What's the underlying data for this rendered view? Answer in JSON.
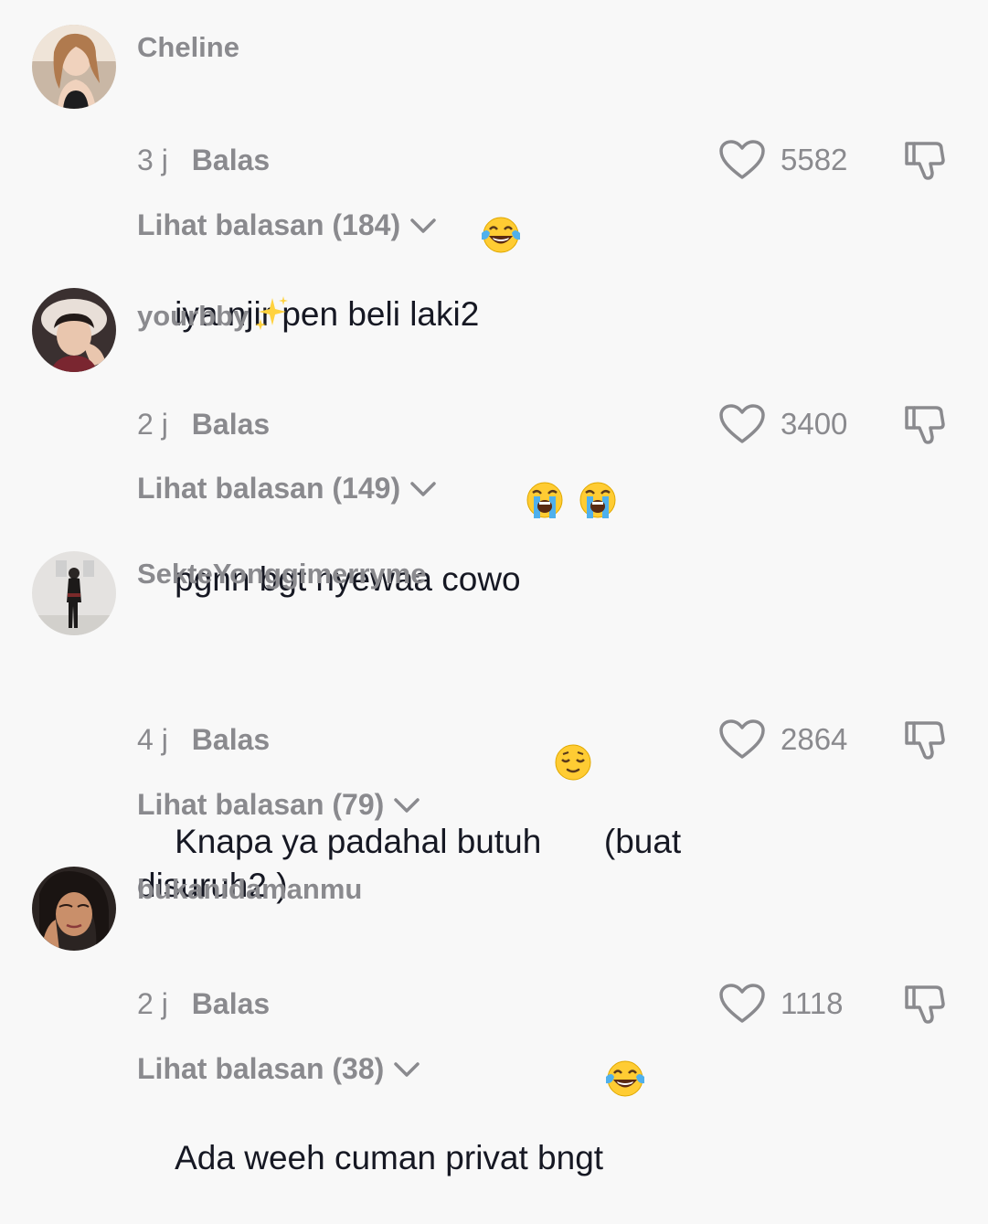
{
  "comments": [
    {
      "username": "Cheline",
      "text": "iya njir pen beli laki2",
      "emoji_after_text": "face-with-tears-of-joy",
      "time": "3 j",
      "reply_label": "Balas",
      "likes": "5582",
      "view_replies": "Lihat balasan (184)"
    },
    {
      "username": "yourbby",
      "username_emoji": "sparkles",
      "text": "pgnn bgt nyewaa cowo",
      "emoji_after_text": "loudly-crying-face x2",
      "time": "2 j",
      "reply_label": "Balas",
      "likes": "3400",
      "view_replies": "Lihat balasan (149)"
    },
    {
      "username": "SekteYonggimerryme",
      "text_line1_before": "Knapa ya padahal butuh ",
      "text_line1_emoji": "relieved-face",
      "text_line1_after": " (buat",
      "text_line2": "disuruh2 )",
      "time": "4 j",
      "reply_label": "Balas",
      "likes": "2864",
      "view_replies": "Lihat balasan (79)"
    },
    {
      "username": "bukanidamanmu",
      "text": "Ada weeh cuman privat bngt",
      "emoji_after_text": "face-with-tears-of-joy",
      "time": "2 j",
      "reply_label": "Balas",
      "likes": "1118",
      "view_replies": "Lihat balasan (38)"
    }
  ],
  "icons": {
    "like": "heart-outline-icon",
    "dislike": "thumbs-down-icon",
    "expand": "chevron-down-icon"
  },
  "colors": {
    "background": "#f8f8f8",
    "text": "#161823",
    "secondary": "#8a8a8e"
  }
}
